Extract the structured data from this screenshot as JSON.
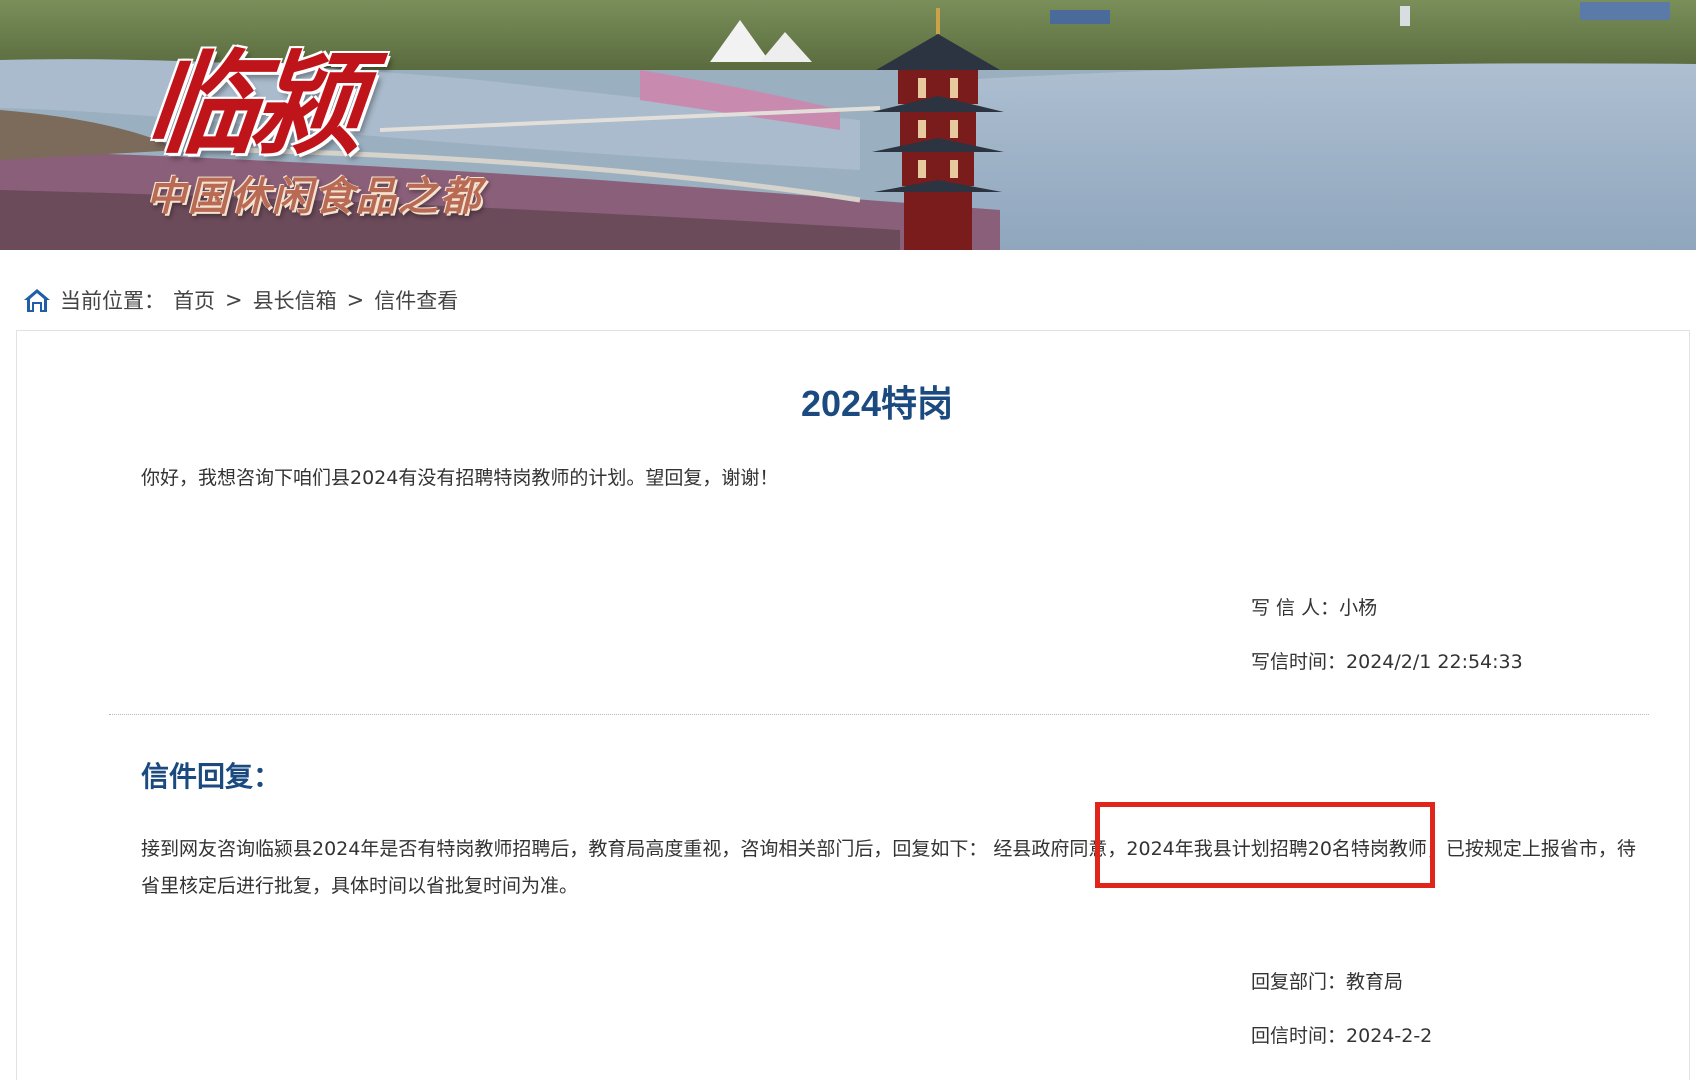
{
  "banner": {
    "logo_main": "临颍",
    "logo_sub": "中国休闲食品之都"
  },
  "breadcrumb": {
    "prefix": "当前位置：",
    "items": [
      "首页",
      "县长信箱",
      "信件查看"
    ],
    "separator": ">"
  },
  "letter": {
    "title": "2024特岗",
    "body": "你好，我想咨询下咱们县2024有没有招聘特岗教师的计划。望回复，谢谢！",
    "writer_label": "写 信 人：",
    "writer": "小杨",
    "time_label": "写信时间：",
    "time": "2024/2/1 22:54:33"
  },
  "reply": {
    "heading": "信件回复：",
    "body": "接到网友咨询临颍县2024年是否有特岗教师招聘后，教育局高度重视，咨询相关部门后，回复如下： 经县政府同意，2024年我县计划招聘20名特岗教师，已按规定上报省市，待省里核定后进行批复，具体时间以省批复时间为准。",
    "dept_label": "回复部门：",
    "dept": "教育局",
    "time_label": "回信时间：",
    "time": "2024-2-2"
  },
  "colors": {
    "title_blue": "#1a4a7f",
    "highlight_red": "#e0251a",
    "logo_red": "#c0141b"
  }
}
